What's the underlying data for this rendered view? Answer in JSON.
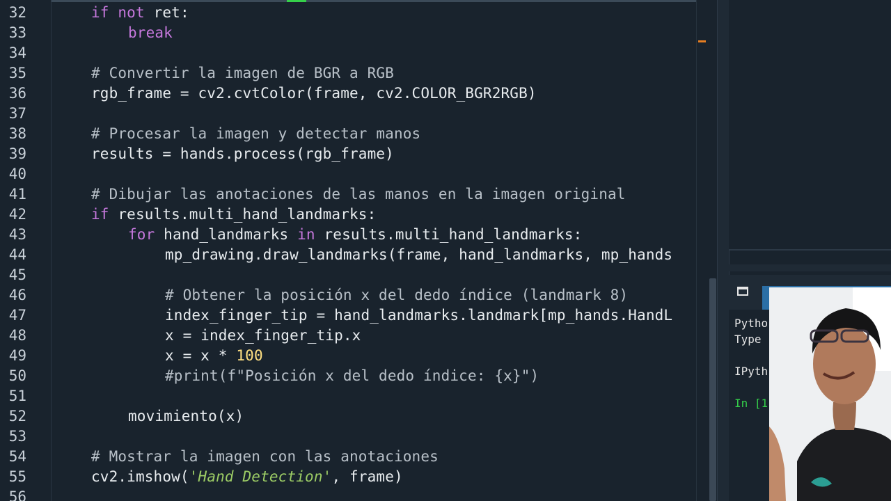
{
  "editor": {
    "lines": [
      {
        "n": "32",
        "indent": 0,
        "tokens": [
          {
            "t": "if",
            "c": "kw"
          },
          {
            "t": " ",
            "c": ""
          },
          {
            "t": "not",
            "c": "kw"
          },
          {
            "t": " ret:",
            "c": ""
          }
        ]
      },
      {
        "n": "33",
        "indent": 1,
        "tokens": [
          {
            "t": "break",
            "c": "kw"
          }
        ]
      },
      {
        "n": "34",
        "indent": 0,
        "tokens": []
      },
      {
        "n": "35",
        "indent": 0,
        "tokens": [
          {
            "t": "# Convertir la imagen de BGR a RGB",
            "c": "cm"
          }
        ]
      },
      {
        "n": "36",
        "indent": 0,
        "tokens": [
          {
            "t": "rgb_frame = cv2.cvtColor(frame, cv2.COLOR_BGR2RGB)",
            "c": ""
          }
        ]
      },
      {
        "n": "37",
        "indent": 0,
        "tokens": []
      },
      {
        "n": "38",
        "indent": 0,
        "tokens": [
          {
            "t": "# Procesar la imagen y detectar manos",
            "c": "cm"
          }
        ]
      },
      {
        "n": "39",
        "indent": 0,
        "tokens": [
          {
            "t": "results = hands.process(rgb_frame)",
            "c": ""
          }
        ]
      },
      {
        "n": "40",
        "indent": 0,
        "tokens": []
      },
      {
        "n": "41",
        "indent": 0,
        "tokens": [
          {
            "t": "# Dibujar las anotaciones de las manos en la imagen original",
            "c": "cm"
          }
        ]
      },
      {
        "n": "42",
        "indent": 0,
        "tokens": [
          {
            "t": "if",
            "c": "kw"
          },
          {
            "t": " results.multi_hand_landmarks:",
            "c": ""
          }
        ]
      },
      {
        "n": "43",
        "indent": 1,
        "tokens": [
          {
            "t": "for",
            "c": "kw"
          },
          {
            "t": " hand_landmarks ",
            "c": ""
          },
          {
            "t": "in",
            "c": "kw"
          },
          {
            "t": " results.multi_hand_landmarks:",
            "c": ""
          }
        ]
      },
      {
        "n": "44",
        "indent": 2,
        "tokens": [
          {
            "t": "mp_drawing.draw_landmarks(frame, hand_landmarks, mp_hands",
            "c": ""
          }
        ]
      },
      {
        "n": "45",
        "indent": 0,
        "tokens": []
      },
      {
        "n": "46",
        "indent": 2,
        "tokens": [
          {
            "t": "# Obtener la posición x del dedo índice (landmark 8)",
            "c": "cm"
          }
        ]
      },
      {
        "n": "47",
        "indent": 2,
        "tokens": [
          {
            "t": "index_finger_tip = hand_landmarks.landmark[mp_hands.HandL",
            "c": ""
          }
        ]
      },
      {
        "n": "48",
        "indent": 2,
        "tokens": [
          {
            "t": "x = index_finger_tip.x",
            "c": ""
          }
        ]
      },
      {
        "n": "49",
        "indent": 2,
        "tokens": [
          {
            "t": "x = x * ",
            "c": ""
          },
          {
            "t": "100",
            "c": "num"
          }
        ]
      },
      {
        "n": "50",
        "indent": 2,
        "tokens": [
          {
            "t": "#print(f\"Posición x del dedo índice: {x}\")",
            "c": "cm"
          }
        ]
      },
      {
        "n": "51",
        "indent": 0,
        "tokens": []
      },
      {
        "n": "52",
        "indent": 1,
        "tokens": [
          {
            "t": "movimiento(x)",
            "c": ""
          }
        ]
      },
      {
        "n": "53",
        "indent": 0,
        "tokens": []
      },
      {
        "n": "54",
        "indent": 0,
        "tokens": [
          {
            "t": "# Mostrar la imagen con las anotaciones",
            "c": "cm"
          }
        ]
      },
      {
        "n": "55",
        "indent": 0,
        "tokens": [
          {
            "t": "cv2.imshow(",
            "c": ""
          },
          {
            "t": "'Hand Detection'",
            "c": "str"
          },
          {
            "t": ", frame)",
            "c": ""
          }
        ]
      },
      {
        "n": "56",
        "indent": 0,
        "tokens": []
      }
    ]
  },
  "console": {
    "lines": [
      {
        "text": "Pytho",
        "cls": ""
      },
      {
        "text": "Type ",
        "cls": ""
      },
      {
        "text": "",
        "cls": ""
      },
      {
        "text": "IPyth",
        "cls": ""
      },
      {
        "text": "",
        "cls": ""
      },
      {
        "text": "In [1",
        "cls": "con-in"
      }
    ]
  },
  "colors": {
    "background": "#19232d",
    "keyword": "#c678dd",
    "comment": "#b8c0c8",
    "number": "#ffe082",
    "string": "#9ccc65",
    "console_prompt": "#35d04a",
    "console_tab": "#2b6fa6",
    "scroll_marker": "#e67e22"
  },
  "icons": {
    "console_window": "console-window-icon"
  }
}
